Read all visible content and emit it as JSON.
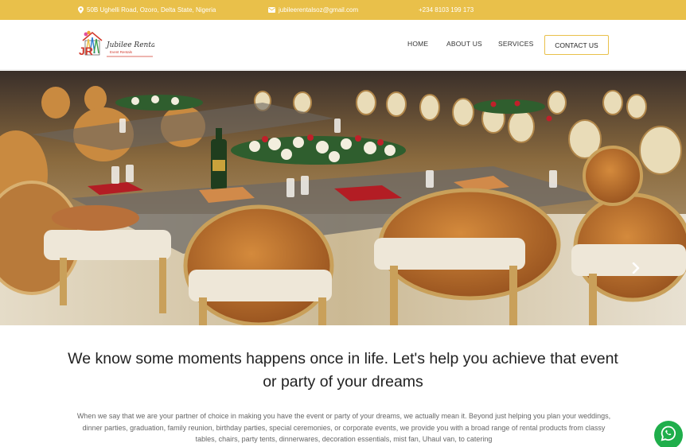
{
  "topbar": {
    "address": "50B Ughelli Road, Ozoro, Delta State, Nigeria",
    "email": "jubileerentalsoz@gmail.com",
    "phone": "+234 8103 199 173",
    "pin_icon": "map-pin-icon",
    "mail_icon": "envelope-icon"
  },
  "logo": {
    "monogram": "JR",
    "name": "Jubilee Rentals",
    "tagline": "Event Rentals"
  },
  "nav": {
    "home": "HOME",
    "about": "ABOUT US",
    "services": "SERVICES",
    "contact": "CONTACT US"
  },
  "hero": {
    "next_icon": "chevron-right-icon"
  },
  "content": {
    "headline": "We know some moments happens once in life. Let's help you achieve that event or party of your dreams",
    "paragraph": "When we say that we are your partner of choice in making you have the event or party of your dreams, we actually mean it. Beyond just helping you plan your weddings, dinner parties, graduation, family reunion, birthday parties, special ceremonies, or corporate events, we provide you with a broad range of rental products from classy tables, chairs, party tents, dinnerwares, decoration essentials, mist fan, Uhaul van, to catering"
  },
  "colors": {
    "accent": "#e9c04a",
    "whatsapp": "#1fae4b",
    "text": "#222222"
  },
  "floating": {
    "whatsapp_icon": "whatsapp-icon"
  }
}
